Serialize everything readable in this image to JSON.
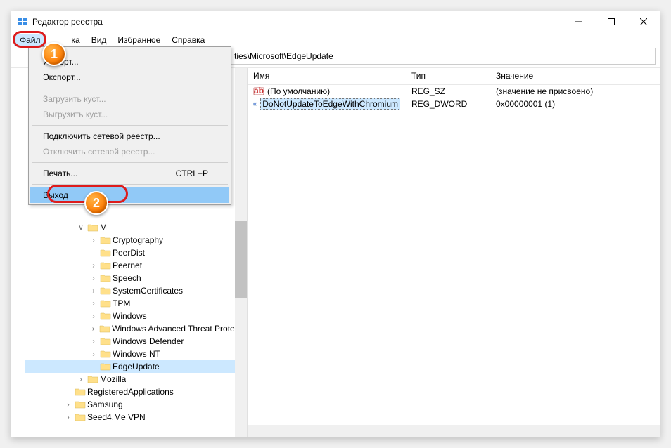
{
  "window": {
    "title": "Редактор реестра"
  },
  "menu": {
    "file": "Файл",
    "edit": "ка",
    "view": "Вид",
    "favorites": "Избранное",
    "help": "Справка"
  },
  "dropdown": {
    "import": "Импорт...",
    "export": "Экспорт...",
    "load_hive": "Загрузить куст...",
    "unload_hive": "Выгрузить куст...",
    "connect": "Подключить сетевой реестр...",
    "disconnect": "Отключить сетевой реестр...",
    "print": "Печать...",
    "print_shortcut": "CTRL+P",
    "exit": "Выход"
  },
  "address": "ties\\Microsoft\\EdgeUpdate",
  "columns": {
    "name": "Имя",
    "type": "Тип",
    "value": "Значение"
  },
  "registry_values": [
    {
      "name": "(По умолчанию)",
      "type": "REG_SZ",
      "value": "(значение не присвоено)",
      "icon": "sz"
    },
    {
      "name": "DoNotUpdateToEdgeWithChromium",
      "type": "REG_DWORD",
      "value": "0x00000001 (1)",
      "icon": "dword",
      "selected": true
    }
  ],
  "tree": {
    "partial_parent": "M",
    "items": [
      {
        "label": "Cryptography",
        "indent": 5,
        "chev": ">"
      },
      {
        "label": "PeerDist",
        "indent": 5,
        "chev": ""
      },
      {
        "label": "Peernet",
        "indent": 5,
        "chev": ">"
      },
      {
        "label": "Speech",
        "indent": 5,
        "chev": ">"
      },
      {
        "label": "SystemCertificates",
        "indent": 5,
        "chev": ">"
      },
      {
        "label": "TPM",
        "indent": 5,
        "chev": ">"
      },
      {
        "label": "Windows",
        "indent": 5,
        "chev": ">"
      },
      {
        "label": "Windows Advanced Threat Protection",
        "indent": 5,
        "chev": ">"
      },
      {
        "label": "Windows Defender",
        "indent": 5,
        "chev": ">"
      },
      {
        "label": "Windows NT",
        "indent": 5,
        "chev": ">"
      },
      {
        "label": "EdgeUpdate",
        "indent": 5,
        "chev": "",
        "selected": true
      },
      {
        "label": "Mozilla",
        "indent": 4,
        "chev": ">"
      },
      {
        "label": "RegisteredApplications",
        "indent": 3,
        "chev": ""
      },
      {
        "label": "Samsung",
        "indent": 3,
        "chev": ">"
      },
      {
        "label": "Seed4.Me VPN",
        "indent": 3,
        "chev": ">"
      }
    ]
  },
  "badges": {
    "one": "1",
    "two": "2"
  }
}
